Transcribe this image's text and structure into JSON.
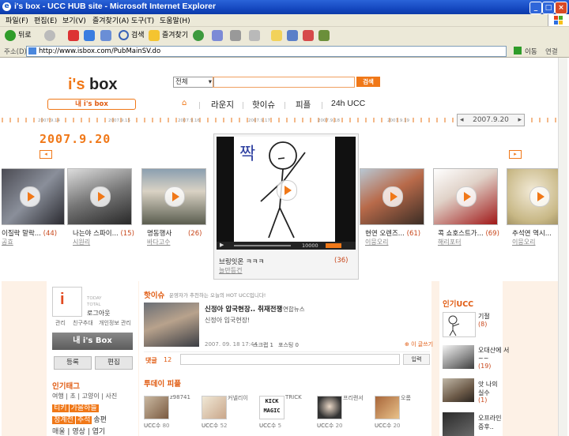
{
  "window": {
    "title": "i's box - UCC HUB site - Microsoft Internet Explorer"
  },
  "menu": [
    "파일(F)",
    "편집(E)",
    "보기(V)",
    "즐겨찾기(A)",
    "도구(T)",
    "도움말(H)"
  ],
  "toolbar": {
    "back": "뒤로",
    "search": "검색",
    "favorites": "즐겨찾기"
  },
  "address": {
    "label": "주소(D)",
    "url": "http://www.isbox.com/PubMainSV.do",
    "go": "이동",
    "links": "연결"
  },
  "site": {
    "logo_i": "i's",
    "logo_box": " box",
    "search_select": "전체",
    "search_button": "검색",
    "my_isbox": "내 i's box",
    "nav": [
      "라운지",
      "핫이슈",
      "피플",
      "24h UCC"
    ],
    "date_nav": "2007.9.20",
    "date_big": "2007.9.20",
    "date_ticks": [
      "2007.9.14",
      "2007.9.15",
      "2007.9.16",
      "2007.9.17",
      "2007.9.18",
      "2007.9.19"
    ]
  },
  "videos": [
    {
      "title": "이질락 말락...",
      "count": "(44)",
      "user": "공효"
    },
    {
      "title": "나는야 스파이...",
      "count": "(15)",
      "user": "시원리"
    },
    {
      "title": "명동행사",
      "count": "(26)",
      "user": "바다고수"
    },
    {
      "title": "브링잇온 ㅋㅋㅋ",
      "count": "(36)",
      "user": "늘만등건"
    },
    {
      "title": "현연 오렌즈...",
      "count": "(61)",
      "user": "이뭉오리"
    },
    {
      "title": "콕 쇼호스트가...",
      "count": "(69)",
      "user": "해리포터"
    },
    {
      "title": "추석연 역시...",
      "count": "",
      "user": "이뭉오리"
    }
  ],
  "featured": {
    "handwriting": "짝",
    "time": "10000"
  },
  "login": {
    "today": "TODAY",
    "total": "TOTAL",
    "login": "로그아웃",
    "links": [
      "관리",
      "친구추대",
      "개인정보 관리"
    ],
    "my_box": "내 i's Box",
    "register": "등록",
    "edit": "편집"
  },
  "hot_issue": {
    "title": "핫이슈",
    "desc": "운영자가 추천하는 오늘의 HOT UCC입니다!",
    "headline": "신정아 압국현장.. 취재전쟁",
    "source": "연합뉴스",
    "body": "신정아 입국현장!",
    "meta_date": "2007. 09. 18 17:44",
    "meta_scrap": "스크랩 1",
    "meta_post": "포스팅 0",
    "more": "이 글쓰기",
    "comment_label": "댓글",
    "comment_count": "12",
    "comment_submit": "입력"
  },
  "popular_tags": {
    "title": "인기태그",
    "line1": "여행 | 초 | 고양이 | 사진",
    "hot_tags": [
      "티키",
      "가을하늘",
      "정계전",
      "추석",
      "송편",
      "매울",
      "영상",
      "엽기"
    ]
  },
  "today_people": {
    "title": "투데이 피플",
    "people": [
      {
        "name": "z98741",
        "ucc": "UCC수",
        "count": "80"
      },
      {
        "name": "커넬리이",
        "ucc": "UCC수",
        "count": "52"
      },
      {
        "name": "TRICK",
        "ucc": "UCC수",
        "count": "5"
      },
      {
        "name": "프리랜서",
        "ucc": "UCC수",
        "count": "20"
      },
      {
        "name": "오롬",
        "ucc": "UCC수",
        "count": "20"
      }
    ]
  },
  "popular_ucc": {
    "title": "인기UCC",
    "items": [
      {
        "title": "기절",
        "count": "(8)"
      },
      {
        "title": "오대산에 서~~",
        "count": "(19)"
      },
      {
        "title": "앗 나의 실수",
        "count": "(1)"
      },
      {
        "title": "오프라인 증후..",
        "count": ""
      }
    ]
  },
  "colors": {
    "accent": "#f07818",
    "titlebar": "#1a4fc4",
    "chrome": "#ece9d8"
  },
  "icons": [
    "back-icon",
    "forward-icon",
    "stop-icon",
    "refresh-icon",
    "home-icon",
    "search-icon",
    "favorites-icon",
    "media-icon",
    "mail-icon",
    "print-icon",
    "play-icon"
  ]
}
